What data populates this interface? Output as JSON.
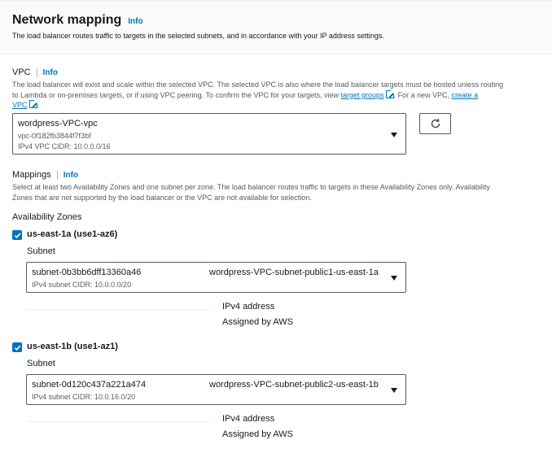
{
  "header": {
    "title": "Network mapping",
    "info": "Info",
    "subtitle": "The load balancer routes traffic to targets in the selected subnets, and in accordance with your IP address settings."
  },
  "vpc": {
    "label": "VPC",
    "info": "Info",
    "desc_line1": "The load balancer will exist and scale within the selected VPC. The selected VPC is also where the load balancer targets must be hosted unless routing",
    "desc_line2_a": "to Lambda or on-premises targets, or if using VPC peering. To confirm the VPC for your targets, view ",
    "desc_link1": "target groups",
    "desc_line2_b": ". For a new VPC, ",
    "desc_link2a": "create a",
    "desc_link2b": "VPC",
    "desc_end": ".",
    "selected_name": "wordpress-VPC-vpc",
    "selected_id": "vpc-0f182fb3844f7f3bf",
    "selected_cidr": "IPv4 VPC CIDR: 10.0.0.0/16"
  },
  "mappings": {
    "label": "Mappings",
    "info": "Info",
    "desc_line1": "Select at least two Availability Zones and one subnet per zone. The load balancer routes traffic to targets in these Availability Zones only. Availability",
    "desc_line2": "Zones that are not supported by the load balancer or the VPC are not available for selection.",
    "az_heading": "Availability Zones",
    "zones": [
      {
        "name": "us-east-1a (use1-az6)",
        "checked": true,
        "subnet_label": "Subnet",
        "subnet_id": "subnet-0b3bb6dff13360a46",
        "subnet_name": "wordpress-VPC-subnet-public1-us-east-1a",
        "subnet_cidr": "IPv4 subnet CIDR: 10.0.0.0/20",
        "ipv4_label": "IPv4 address",
        "ipv4_value": "Assigned by AWS"
      },
      {
        "name": "us-east-1b (use1-az1)",
        "checked": true,
        "subnet_label": "Subnet",
        "subnet_id": "subnet-0d120c437a221a474",
        "subnet_name": "wordpress-VPC-subnet-public2-us-east-1b",
        "subnet_cidr": "IPv4 subnet CIDR: 10.0.16.0/20",
        "ipv4_label": "IPv4 address",
        "ipv4_value": "Assigned by AWS"
      }
    ]
  },
  "colors": {
    "link": "#0073bb",
    "text": "#16191f",
    "secondary": "#545b64",
    "border": "#545b64",
    "header_bg": "#fafafa"
  },
  "icons": {
    "refresh": "refresh-icon",
    "external": "external-link-icon",
    "caret": "caret-down-icon",
    "check": "checkmark-icon"
  }
}
